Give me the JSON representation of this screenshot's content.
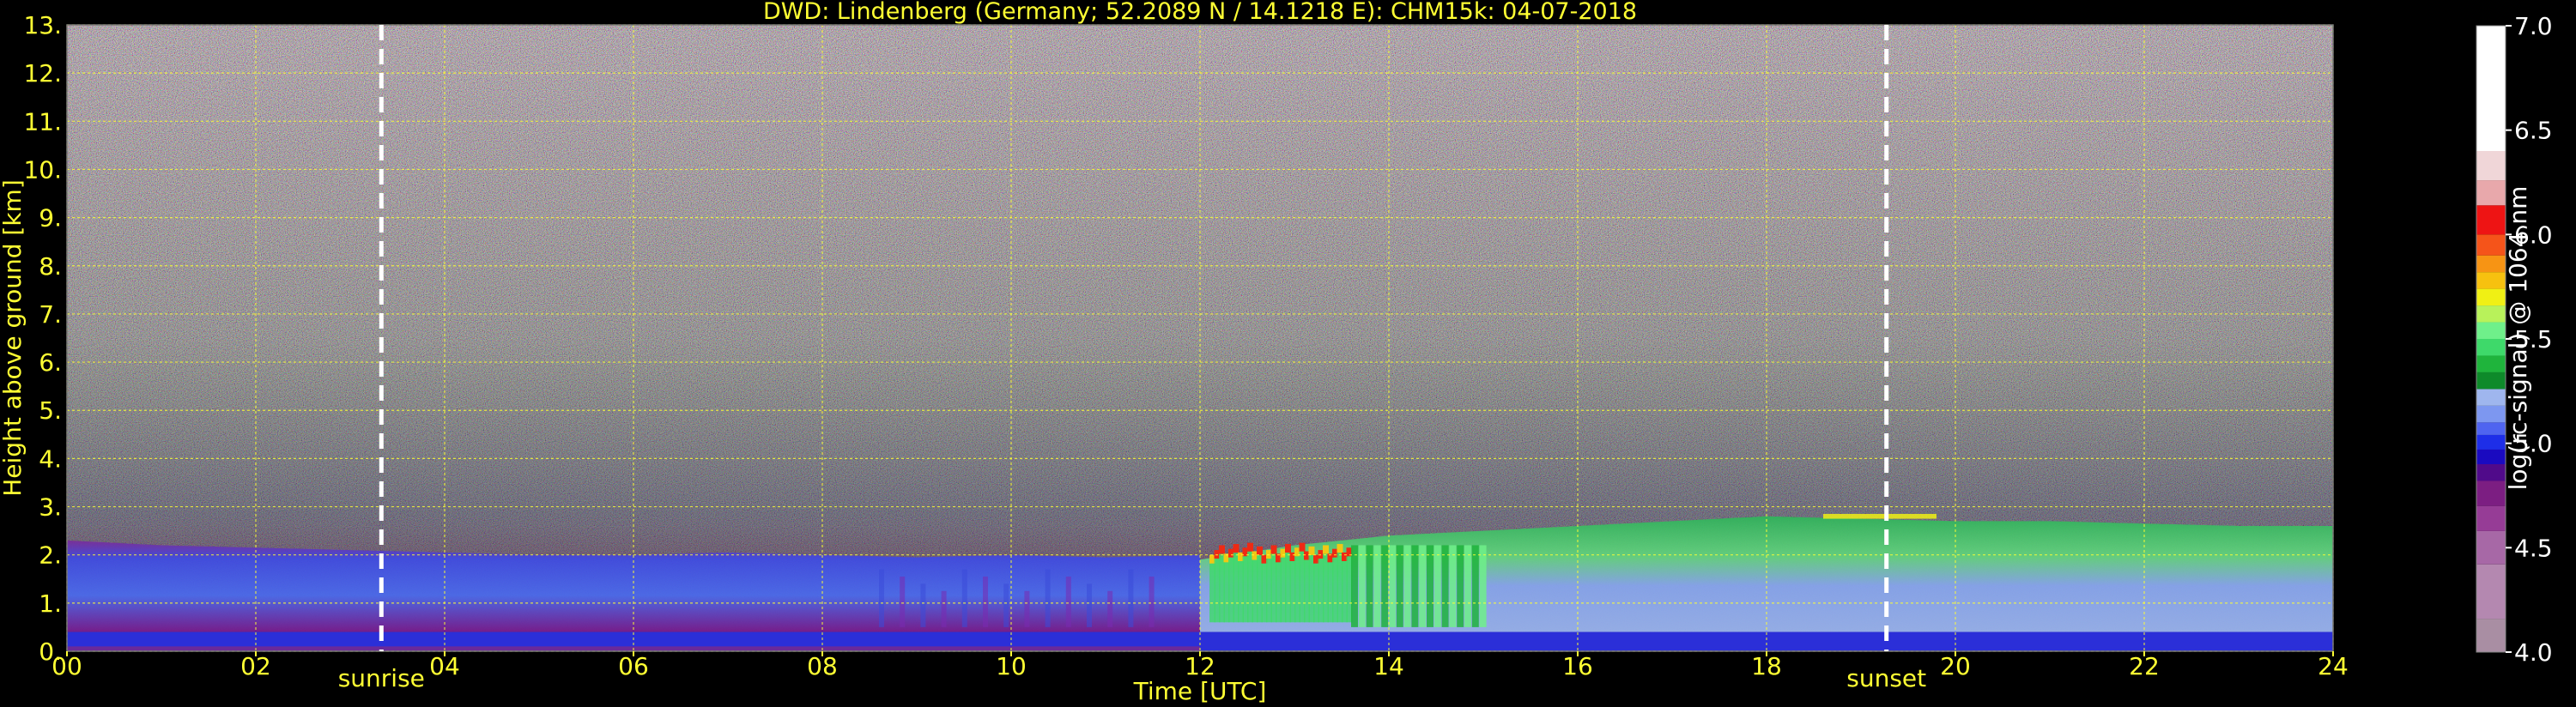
{
  "chart_data": {
    "type": "heatmap",
    "title": "DWD: Lindenberg (Germany; 52.2089 N / 14.1218 E):    CHM15k: 04-07-2018",
    "xlabel": "Time [UTC]",
    "ylabel": "Height above ground [km]",
    "xlim": [
      0,
      24
    ],
    "ylim": [
      0,
      13
    ],
    "x_ticks": [
      {
        "value": 0,
        "label": "00"
      },
      {
        "value": 2,
        "label": "02"
      },
      {
        "value": 4,
        "label": "04"
      },
      {
        "value": 6,
        "label": "06"
      },
      {
        "value": 8,
        "label": "08"
      },
      {
        "value": 10,
        "label": "10"
      },
      {
        "value": 12,
        "label": "12"
      },
      {
        "value": 14,
        "label": "14"
      },
      {
        "value": 16,
        "label": "16"
      },
      {
        "value": 18,
        "label": "18"
      },
      {
        "value": 20,
        "label": "20"
      },
      {
        "value": 22,
        "label": "22"
      },
      {
        "value": 24,
        "label": "24"
      }
    ],
    "y_ticks": [
      {
        "value": 0,
        "label": "0."
      },
      {
        "value": 1,
        "label": "1."
      },
      {
        "value": 2,
        "label": "2."
      },
      {
        "value": 3,
        "label": "3."
      },
      {
        "value": 4,
        "label": "4."
      },
      {
        "value": 5,
        "label": "5."
      },
      {
        "value": 6,
        "label": "6."
      },
      {
        "value": 7,
        "label": "7."
      },
      {
        "value": 8,
        "label": "8."
      },
      {
        "value": 9,
        "label": "9."
      },
      {
        "value": 10,
        "label": "10."
      },
      {
        "value": 11,
        "label": "11."
      },
      {
        "value": 12,
        "label": "12."
      },
      {
        "value": 13,
        "label": "13."
      }
    ],
    "grid": true,
    "vlines": [
      {
        "x": 3.33,
        "label": "sunrise"
      },
      {
        "x": 19.27,
        "label": "sunset"
      }
    ],
    "colorbar": {
      "label": "log(rc-signal) @ 1064 nm",
      "range": [
        4.0,
        7.0
      ],
      "ticks": [
        {
          "value": 4.0,
          "label": "4.0"
        },
        {
          "value": 4.5,
          "label": "4.5"
        },
        {
          "value": 5.0,
          "label": "5.0"
        },
        {
          "value": 5.5,
          "label": "5.5"
        },
        {
          "value": 6.0,
          "label": "6.0"
        },
        {
          "value": 6.5,
          "label": "6.5"
        },
        {
          "value": 7.0,
          "label": "7.0"
        }
      ],
      "stops": [
        {
          "from": 4.0,
          "to": 4.16,
          "color": "#a98ea3"
        },
        {
          "from": 4.16,
          "to": 4.42,
          "color": "#b488b0"
        },
        {
          "from": 4.42,
          "to": 4.58,
          "color": "#a768a6"
        },
        {
          "from": 4.58,
          "to": 4.7,
          "color": "#963c96"
        },
        {
          "from": 4.7,
          "to": 4.82,
          "color": "#7c1e82"
        },
        {
          "from": 4.82,
          "to": 4.9,
          "color": "#500a8a"
        },
        {
          "from": 4.9,
          "to": 4.97,
          "color": "#1a0ac0"
        },
        {
          "from": 4.97,
          "to": 5.04,
          "color": "#1e2ee8"
        },
        {
          "from": 5.04,
          "to": 5.1,
          "color": "#4f64f0"
        },
        {
          "from": 5.1,
          "to": 5.18,
          "color": "#7d97f0"
        },
        {
          "from": 5.18,
          "to": 5.26,
          "color": "#9fb6ee"
        },
        {
          "from": 5.26,
          "to": 5.34,
          "color": "#0e8a2a"
        },
        {
          "from": 5.34,
          "to": 5.42,
          "color": "#1fb43c"
        },
        {
          "from": 5.42,
          "to": 5.5,
          "color": "#3ed96a"
        },
        {
          "from": 5.5,
          "to": 5.58,
          "color": "#6ff08a"
        },
        {
          "from": 5.58,
          "to": 5.66,
          "color": "#b8f25a"
        },
        {
          "from": 5.66,
          "to": 5.74,
          "color": "#f0f014"
        },
        {
          "from": 5.74,
          "to": 5.82,
          "color": "#f7c10f"
        },
        {
          "from": 5.82,
          "to": 5.9,
          "color": "#f79414"
        },
        {
          "from": 5.9,
          "to": 6.0,
          "color": "#f5541a"
        },
        {
          "from": 6.0,
          "to": 6.14,
          "color": "#ee1414"
        },
        {
          "from": 6.14,
          "to": 6.26,
          "color": "#e8a8ab"
        },
        {
          "from": 6.26,
          "to": 6.4,
          "color": "#f0d6d8"
        },
        {
          "from": 6.4,
          "to": 7.0,
          "color": "#ffffff"
        }
      ]
    },
    "features": [
      {
        "name": "surface layer",
        "t": [
          0,
          24
        ],
        "h": [
          0,
          0.4
        ],
        "value": 4.9
      },
      {
        "name": "boundary layer aerosol",
        "t": [
          0,
          12
        ],
        "h": [
          0.4,
          2.2
        ],
        "value": 5.1
      },
      {
        "name": "mixed layer aerosol",
        "t": [
          12,
          24
        ],
        "h": [
          0.4,
          2.7
        ],
        "value": 5.45
      },
      {
        "name": "cumulus cloud tops",
        "t": [
          12.1,
          13.6
        ],
        "h": [
          1.9,
          2.3
        ],
        "value": 6.05
      },
      {
        "name": "elevated layer",
        "t": [
          18.6,
          19.8
        ],
        "h": [
          2.75,
          2.85
        ],
        "value": 5.75
      }
    ]
  }
}
